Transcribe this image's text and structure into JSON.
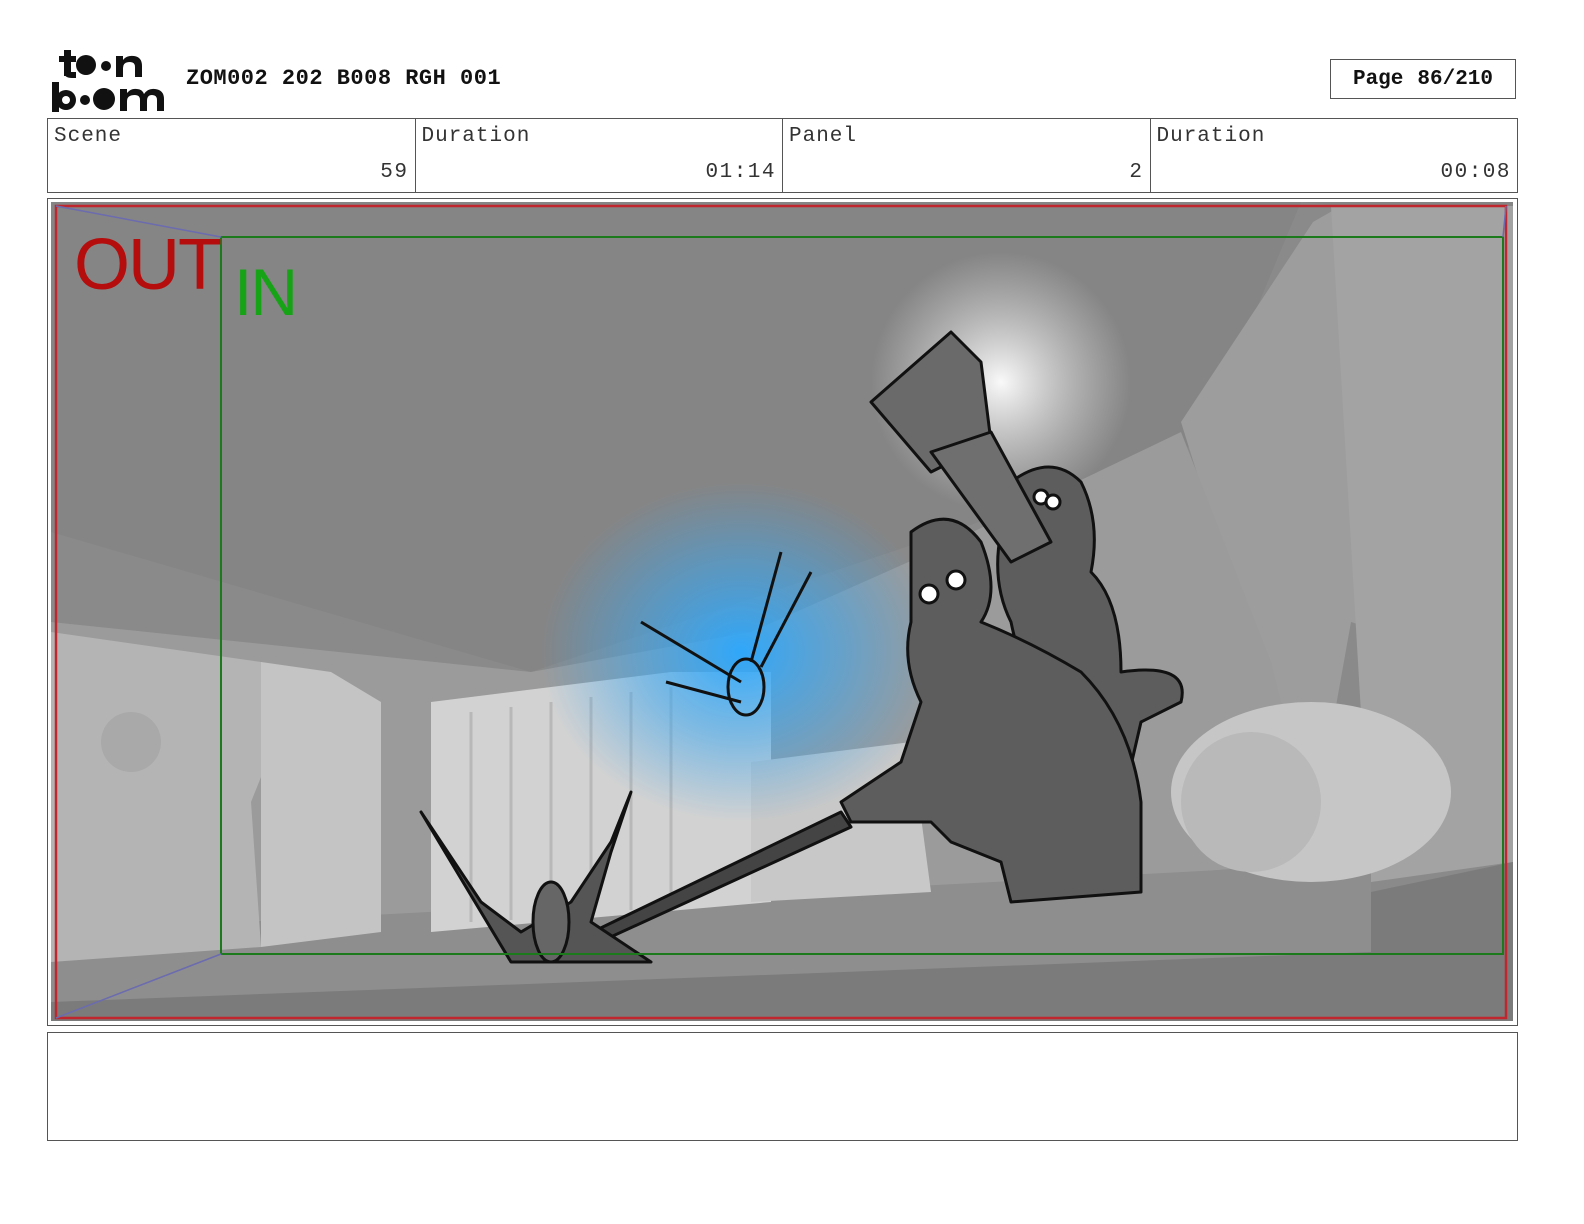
{
  "header": {
    "logo_text_top": "toon",
    "logo_text_bottom": "boom",
    "title": "ZOM002 202 B008 RGH 001",
    "page_label": "Page",
    "page_value": "86/210"
  },
  "info": {
    "scene_label": "Scene",
    "scene_value": "59",
    "scene_duration_label": "Duration",
    "scene_duration_value": "01:14",
    "panel_label": "Panel",
    "panel_value": "2",
    "panel_duration_label": "Duration",
    "panel_duration_value": "00:08"
  },
  "panel": {
    "out_label": "OUT",
    "in_label": "IN",
    "out_frame_color": "#c0262d",
    "in_frame_color": "#1c7a1c",
    "glow_color": "#3fb3ff"
  },
  "caption": {
    "text": ""
  }
}
